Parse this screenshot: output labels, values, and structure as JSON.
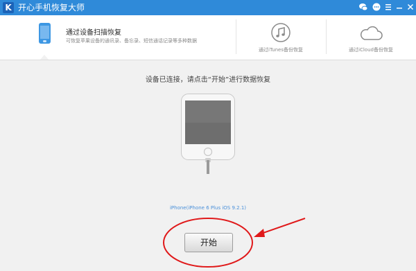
{
  "app": {
    "title": "开心手机恢复大师",
    "logo_letter": "K"
  },
  "window_controls": [
    "wechat-icon",
    "chat-icon",
    "menu-icon",
    "minimize-icon",
    "close-icon"
  ],
  "nav": {
    "primary": {
      "title": "通过设备扫描恢复",
      "description": "可恢复苹果设备的通讯录、备忘录、短信通话记录等多种数据",
      "icon": "phone-icon"
    },
    "itunes": {
      "label": "通过iTunes备份恢复",
      "icon": "music-note-icon"
    },
    "icloud": {
      "label": "通过iCloud备份恢复",
      "icon": "cloud-icon"
    }
  },
  "main": {
    "message": "设备已连接，请点击“开始”进行数据恢复",
    "device_info": "iPhone(iPhone 6 Plus iOS 9.2.1)",
    "start_label": "开始"
  },
  "colors": {
    "titlebar": "#2f8ad9",
    "accent": "#3d97e3",
    "annotation": "#e0191a"
  }
}
